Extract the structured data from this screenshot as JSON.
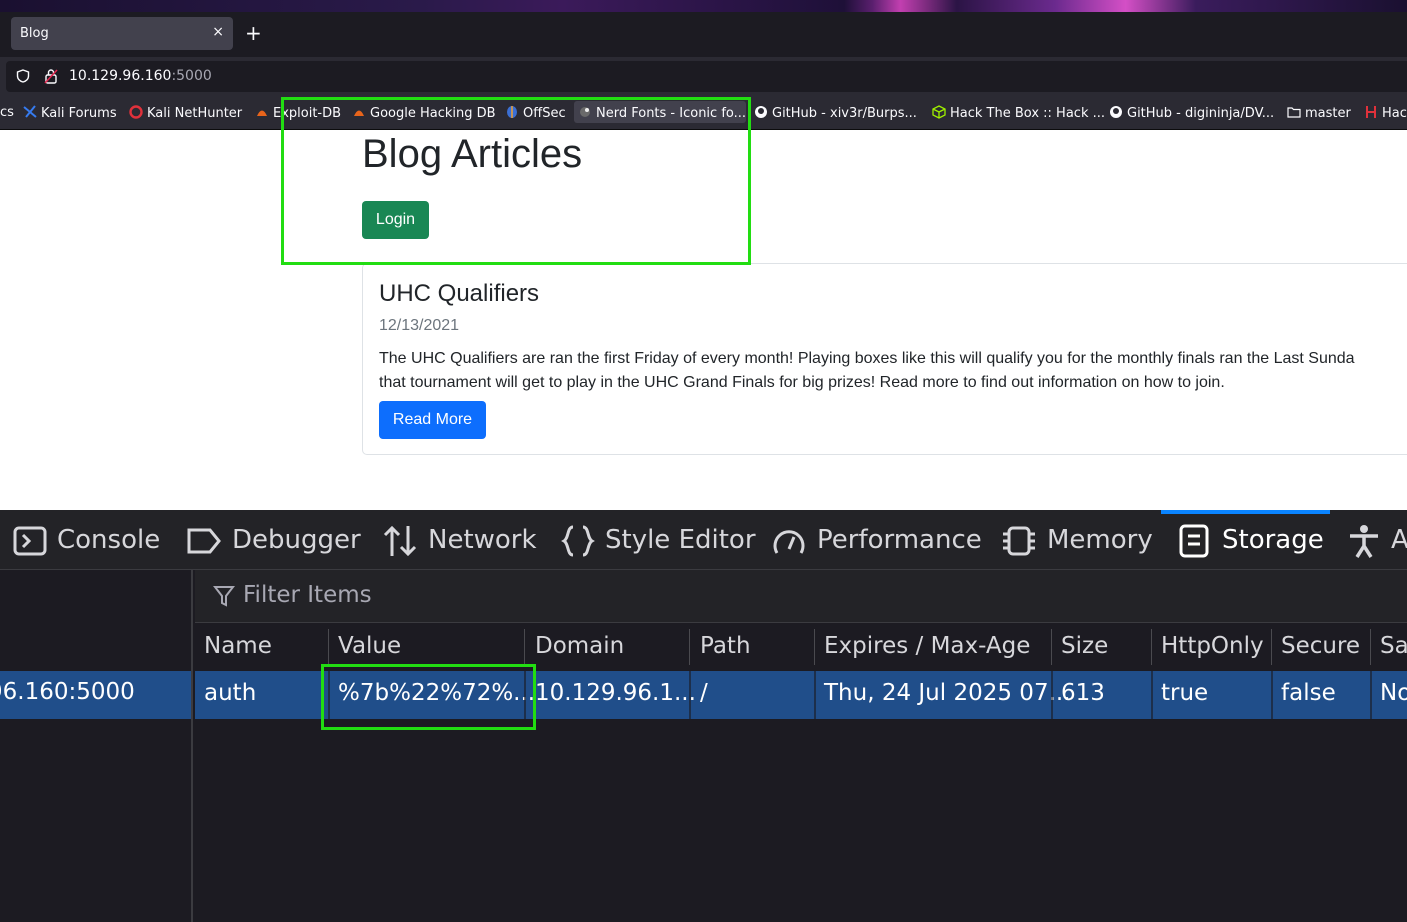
{
  "browser": {
    "tab_title": "Blog",
    "tab_close": "×",
    "new_tab": "+",
    "url_host": "10.129.96.160",
    "url_port": ":5000"
  },
  "bookmarks": [
    {
      "label": "cs",
      "icon": "partial-icon"
    },
    {
      "label": "Kali Forums",
      "icon": "kali-dragon-icon"
    },
    {
      "label": "Kali NetHunter",
      "icon": "nethunter-icon"
    },
    {
      "label": "Exploit-DB",
      "icon": "exploitdb-icon"
    },
    {
      "label": "Google Hacking DB",
      "icon": "ghdb-icon"
    },
    {
      "label": "OffSec",
      "icon": "offsec-icon"
    },
    {
      "label": "Nerd Fonts - Iconic fo...",
      "icon": "nerdfonts-icon"
    },
    {
      "label": "GitHub - xiv3r/Burps...",
      "icon": "github-icon"
    },
    {
      "label": "Hack The Box :: Hack ...",
      "icon": "htb-cube-icon"
    },
    {
      "label": "GitHub - digininja/DV...",
      "icon": "github-icon"
    },
    {
      "label": "master",
      "icon": "folder-icon"
    },
    {
      "label": "Hac",
      "icon": "hacktricks-icon"
    }
  ],
  "page": {
    "title": "Blog Articles",
    "login_label": "Login",
    "article": {
      "title": "UHC Qualifiers",
      "date": "12/13/2021",
      "line1": "The UHC Qualifiers are ran the first Friday of every month! Playing boxes like this will qualify you for the monthly finals ran the Last Sunda",
      "line2": "that tournament will get to play in the UHC Grand Finals for big prizes! Read more to find out information on how to join.",
      "read_more_label": "Read More"
    }
  },
  "devtools": {
    "tabs": [
      {
        "label": "Console",
        "icon": "console-icon"
      },
      {
        "label": "Debugger",
        "icon": "debugger-icon"
      },
      {
        "label": "Network",
        "icon": "network-arrows-icon"
      },
      {
        "label": "Style Editor",
        "icon": "braces-icon"
      },
      {
        "label": "Performance",
        "icon": "gauge-icon"
      },
      {
        "label": "Memory",
        "icon": "chip-icon"
      },
      {
        "label": "Storage",
        "icon": "storage-icon"
      },
      {
        "label": "A",
        "icon": "accessibility-icon"
      }
    ],
    "active_tab": "Storage",
    "sidebar_host": "96.160:5000",
    "filter_placeholder": "Filter Items",
    "columns": [
      "Name",
      "Value",
      "Domain",
      "Path",
      "Expires / Max-Age",
      "Size",
      "HttpOnly",
      "Secure",
      "Sa"
    ],
    "cookie": {
      "name": "auth",
      "value": "%7b%22%72%...",
      "domain": "10.129.96.1...",
      "path": "/",
      "expires": "Thu, 24 Jul 2025 07...",
      "size": "613",
      "httponly": "true",
      "secure": "false",
      "samesite": "No"
    }
  },
  "colors": {
    "login_button": "#198754",
    "read_more_button": "#0d6efd",
    "highlight": "#22dd12",
    "selected_row": "#204e8a"
  }
}
